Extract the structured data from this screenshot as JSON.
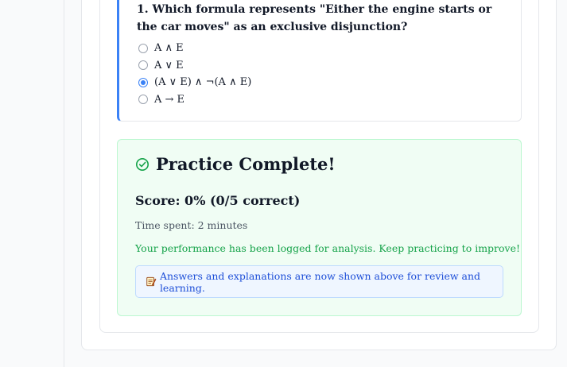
{
  "question": {
    "number": "1.",
    "text": "1. Which formula represents \"Either the engine starts or the car moves\" as an exclusive disjunction?",
    "options": [
      {
        "label": "A ∧ E",
        "selected": false
      },
      {
        "label": "A ∨ E",
        "selected": false
      },
      {
        "label": "(A ∨ E) ∧ ¬(A ∧ E)",
        "selected": true
      },
      {
        "label": "A → E",
        "selected": false
      }
    ]
  },
  "result": {
    "title": "Practice Complete!",
    "score": "Score: 0% (0/5 correct)",
    "time_spent": "Time spent: 2 minutes",
    "logged_message": "Your performance has been logged for analysis. Keep practicing to improve!",
    "review_message": "Answers and explanations are now shown above for review and learning.",
    "icon": "check-circle-icon",
    "review_icon": "memo-icon"
  },
  "colors": {
    "accent": "#3b82f6",
    "success": "#16a34a",
    "success_bg": "#f0fdf4",
    "info": "#1d4ed8",
    "info_bg": "#eff6ff"
  }
}
